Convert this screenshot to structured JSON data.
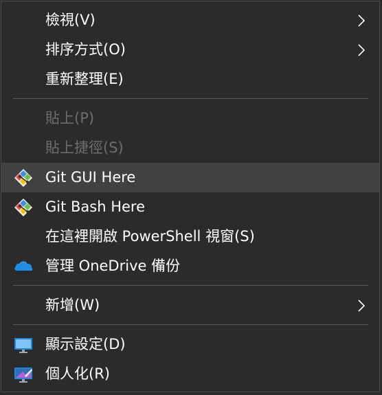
{
  "menu": {
    "items": [
      {
        "label": "檢視(V)",
        "submenu": true
      },
      {
        "label": "排序方式(O)",
        "submenu": true
      },
      {
        "label": "重新整理(E)"
      },
      {
        "label": "貼上(P)",
        "disabled": true
      },
      {
        "label": "貼上捷徑(S)",
        "disabled": true
      },
      {
        "label": "Git GUI Here",
        "icon": "git-gui-icon",
        "highlighted": true
      },
      {
        "label": "Git Bash Here",
        "icon": "git-bash-icon"
      },
      {
        "label": "在這裡開啟 PowerShell 視窗(S)"
      },
      {
        "label": "管理 OneDrive 備份",
        "icon": "onedrive-cloud-icon"
      },
      {
        "label": "新增(W)",
        "submenu": true
      },
      {
        "label": "顯示設定(D)",
        "icon": "display-settings-icon"
      },
      {
        "label": "個人化(R)",
        "icon": "personalize-icon"
      }
    ]
  },
  "colors": {
    "background": "#2b2b2b",
    "hover": "#414141",
    "text": "#ffffff",
    "disabled_text": "#6d6d6d",
    "separator": "#5a5a5a",
    "onedrive_blue": "#1f8ce6"
  }
}
